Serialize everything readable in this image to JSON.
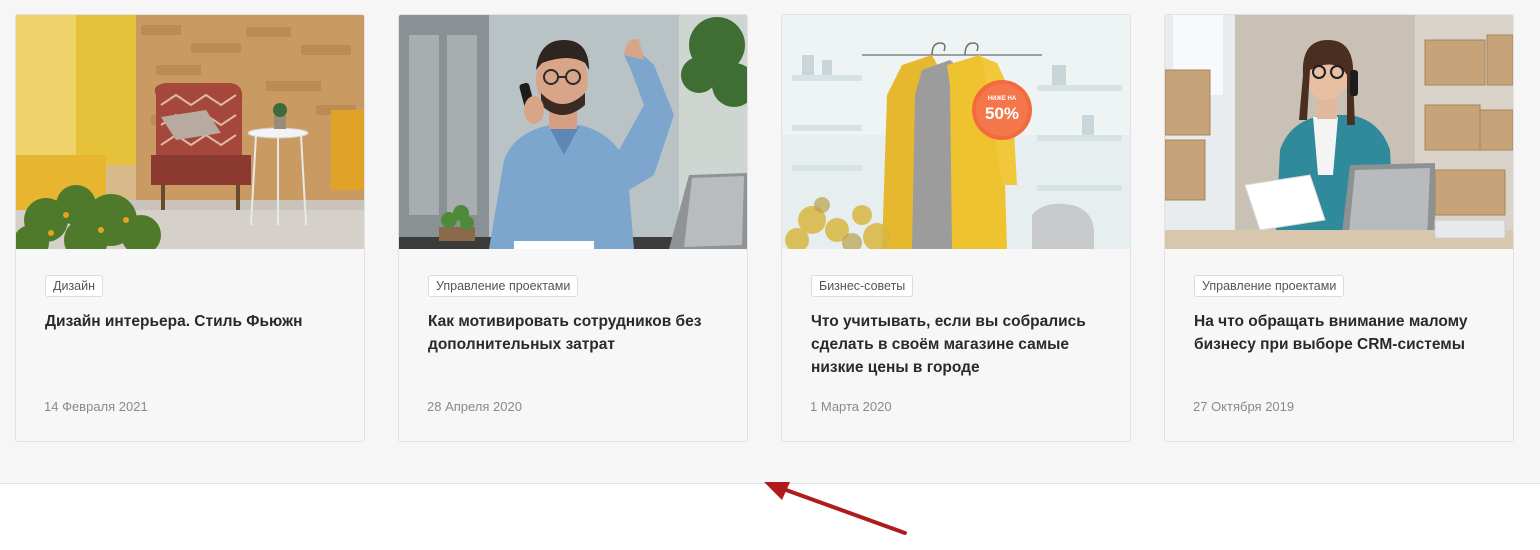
{
  "cards": [
    {
      "image": "interior-armchair-photo",
      "tag": "Дизайн",
      "title": "Дизайн интерьера. Стиль Фьюжн",
      "date": "14 Февраля 2021"
    },
    {
      "image": "man-on-phone-photo",
      "tag": "Управление проектами",
      "title": "Как мотивировать сотрудников без дополнительных затрат",
      "date": "28 Апреля 2020"
    },
    {
      "image": "clothes-sale-photo",
      "badge_top": "НИЖЕ НА",
      "badge_main": "50%",
      "tag": "Бизнес-советы",
      "title": "Что учитывать, если вы собрались сделать в своём магазине самые низкие цены в городе",
      "date": "1 Марта 2020"
    },
    {
      "image": "woman-office-boxes-photo",
      "tag": "Управление проектами",
      "title": "На что обращать внимание малому бизнесу при выборе CRM-системы",
      "date": "27 Октября 2019"
    }
  ],
  "annotation": {
    "icon": "red-arrow-icon",
    "color": "#b01c1c"
  }
}
